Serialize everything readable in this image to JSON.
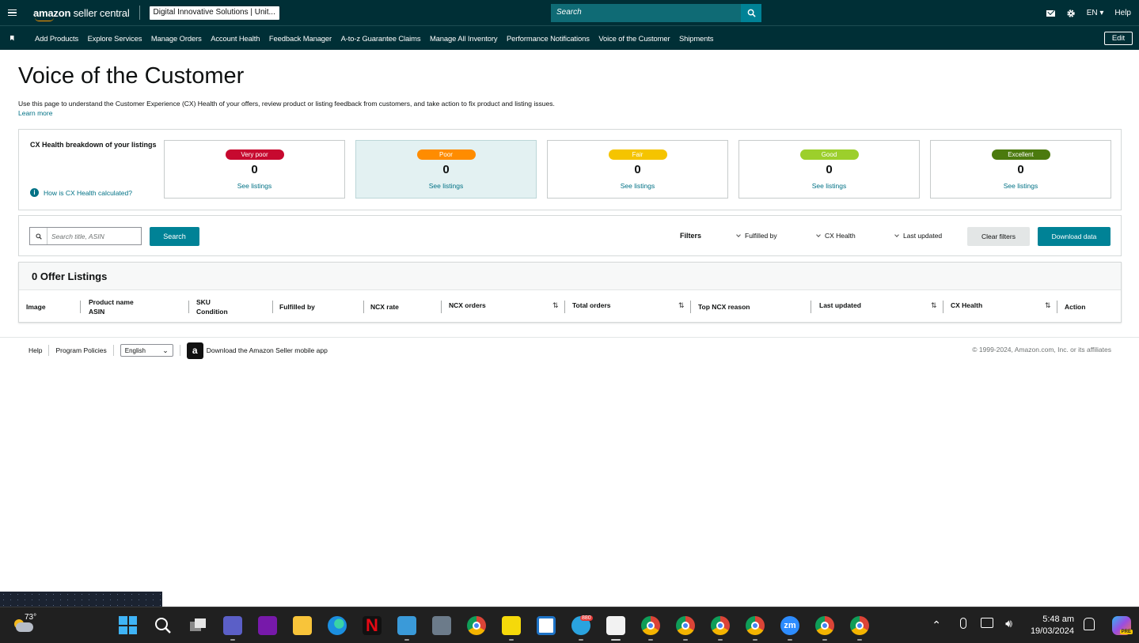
{
  "header": {
    "logo_text_bold": "amazon",
    "logo_text": " seller central",
    "account": "Digital Innovative Solutions | Unit...",
    "search_placeholder": "Search",
    "language": "EN",
    "help": "Help"
  },
  "nav": {
    "items": [
      "Add Products",
      "Explore Services",
      "Manage Orders",
      "Account Health",
      "Feedback Manager",
      "A-to-z Guarantee Claims",
      "Manage All Inventory",
      "Performance Notifications",
      "Voice of the Customer",
      "Shipments"
    ],
    "edit": "Edit"
  },
  "page": {
    "title": "Voice of the Customer",
    "intro": "Use this page to understand the Customer Experience (CX) Health of your offers, review product or listing feedback from customers, and take action to fix product and listing issues.",
    "learn_more": "Learn more"
  },
  "cx_health": {
    "heading": "CX Health breakdown of your listings",
    "how_link": "How is CX Health calculated?",
    "tiles": [
      {
        "label": "Very poor",
        "count": "0",
        "link": "See listings",
        "color": "#c7092f"
      },
      {
        "label": "Poor",
        "count": "0",
        "link": "See listings",
        "color": "#ff8c00"
      },
      {
        "label": "Fair",
        "count": "0",
        "link": "See listings",
        "color": "#f5c400"
      },
      {
        "label": "Good",
        "count": "0",
        "link": "See listings",
        "color": "#9ccf2c"
      },
      {
        "label": "Excellent",
        "count": "0",
        "link": "See listings",
        "color": "#4b7a0e"
      }
    ]
  },
  "filters": {
    "search_placeholder": "Search title, ASIN",
    "search_button": "Search",
    "label": "Filters",
    "fulfilled_by": "Fulfilled by",
    "cx_health": "CX Health",
    "last_updated": "Last updated",
    "clear": "Clear filters",
    "download": "Download data"
  },
  "table": {
    "title": "0 Offer Listings",
    "columns": {
      "image": "Image",
      "product_name": "Product name",
      "asin": "ASIN",
      "sku": "SKU",
      "condition": "Condition",
      "fulfilled_by": "Fulfilled by",
      "ncx_rate": "NCX rate",
      "ncx_orders": "NCX orders",
      "total_orders": "Total orders",
      "top_ncx_reason": "Top NCX reason",
      "last_updated": "Last updated",
      "cx_health": "CX Health",
      "action": "Action"
    }
  },
  "footer": {
    "help": "Help",
    "program_policies": "Program Policies",
    "language": "English",
    "app_text": "Download the Amazon Seller mobile app",
    "copyright": "© 1999-2024, Amazon.com, Inc. or its affiliates"
  },
  "taskbar": {
    "temperature": "73°",
    "telegram_badge": "880",
    "time": "5:48 am",
    "date": "19/03/2024",
    "copilot_badge": "PRE"
  },
  "colors": {
    "header_bg": "#002f36",
    "accent": "#008296",
    "link": "#007185"
  }
}
